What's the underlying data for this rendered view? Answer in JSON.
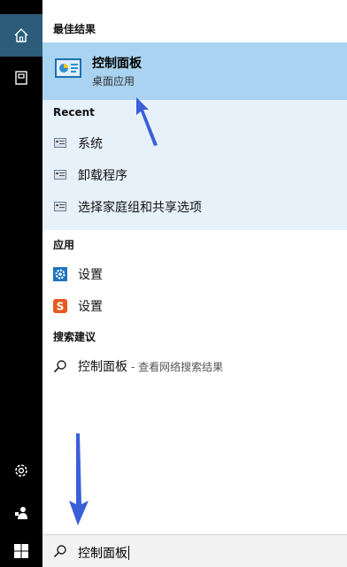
{
  "rail": {
    "home_icon": "home-icon",
    "documents_icon": "documents-icon",
    "settings_icon": "settings-gear-icon",
    "user_icon": "user-icon",
    "start_icon": "windows-start-icon"
  },
  "best_match": {
    "header": "最佳结果",
    "title": "控制面板",
    "subtitle": "桌面应用"
  },
  "recent": {
    "header": "Recent",
    "items": [
      {
        "label": "系统"
      },
      {
        "label": "卸载程序"
      },
      {
        "label": "选择家庭组和共享选项"
      }
    ]
  },
  "apps": {
    "header": "应用",
    "items": [
      {
        "label": "设置"
      },
      {
        "label": "设置"
      }
    ]
  },
  "suggestions": {
    "header": "搜索建议",
    "query": "控制面板",
    "hint": "- 查看网络搜索结果"
  },
  "search": {
    "value": "控制面板"
  },
  "colors": {
    "accent": "#2b5d7a",
    "best_bg": "#a9d3f0",
    "recent_bg": "#e6f1fa",
    "arrow": "#3a5fd8"
  }
}
